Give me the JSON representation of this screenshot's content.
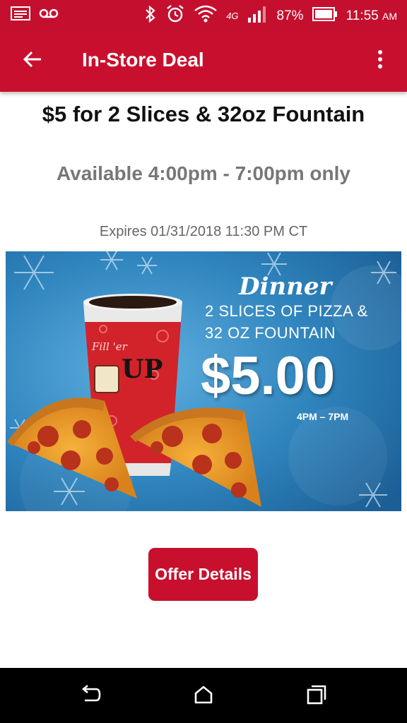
{
  "status_bar": {
    "battery_percent": "87%",
    "time": "11:55",
    "time_suffix": "AM",
    "network_label": "4G",
    "icons": [
      "screenshot-icon",
      "voicemail-icon",
      "bluetooth-icon",
      "alarm-icon",
      "wifi-icon",
      "signal-icon",
      "battery-icon"
    ]
  },
  "app_bar": {
    "title": "In-Store Deal",
    "back_icon": "arrow-left-icon",
    "menu_icon": "more-vertical-icon"
  },
  "deal": {
    "headline": "$5 for 2 Slices & 32oz Fountain",
    "availability": "Available 4:00pm - 7:00pm only",
    "expires": "Expires 01/31/2018 11:30 PM CT"
  },
  "promo": {
    "heading": "Dinner",
    "line1": "2 SLICES OF PIZZA &",
    "line2": "32 OZ FOUNTAIN",
    "price": "$5.00",
    "hours": "4PM – 7PM",
    "cup_script": "Fill 'er",
    "cup_big": "UP",
    "colors": {
      "background": "#2e7fb8",
      "cup": "#d2232a"
    }
  },
  "offer_button": {
    "label": "Offer Details"
  },
  "nav_bar": {
    "icons": [
      "back-nav-icon",
      "home-nav-icon",
      "recents-nav-icon"
    ]
  },
  "theme": {
    "primary": "#c8102e",
    "nav_background": "#000000"
  }
}
